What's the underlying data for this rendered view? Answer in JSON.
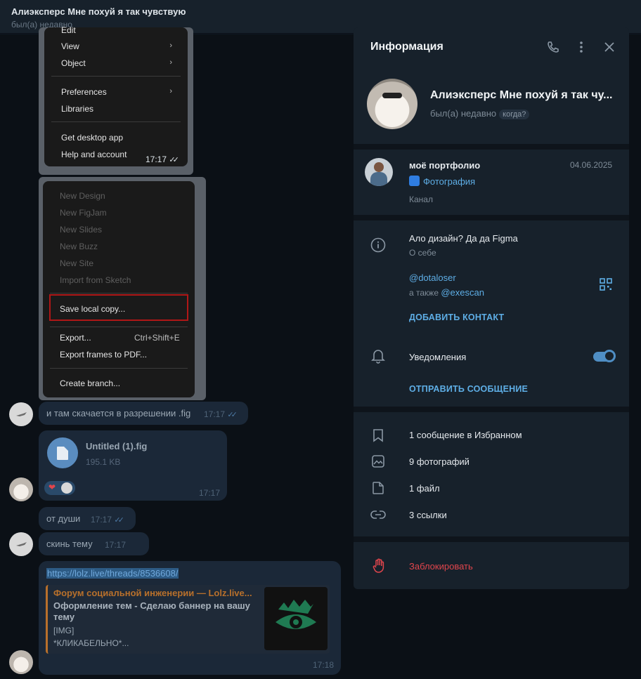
{
  "header": {
    "title": "Алиэксперс Мне похуй я так чувствую",
    "status": "был(а) недавно"
  },
  "menu1": {
    "items": [
      {
        "label": "Edit",
        "arrow": false
      },
      {
        "label": "View",
        "arrow": true
      },
      {
        "label": "Object",
        "arrow": true
      },
      {
        "label": "Preferences",
        "arrow": true
      },
      {
        "label": "Libraries",
        "arrow": false
      },
      {
        "label": "Get desktop app",
        "arrow": false
      },
      {
        "label": "Help and account",
        "arrow": false
      }
    ],
    "time": "17:17"
  },
  "menu2": {
    "items": [
      {
        "label": "New Design",
        "disabled": true
      },
      {
        "label": "New FigJam",
        "disabled": true
      },
      {
        "label": "New Slides",
        "disabled": true
      },
      {
        "label": "New Buzz",
        "disabled": true
      },
      {
        "label": "New Site",
        "disabled": true
      },
      {
        "label": "Import from Sketch",
        "disabled": true
      },
      {
        "label": "Save local copy...",
        "disabled": false
      },
      {
        "label": "Export...",
        "disabled": false
      },
      {
        "label": "Export frames to PDF...",
        "disabled": false
      },
      {
        "label": "Create branch...",
        "disabled": false
      }
    ],
    "export_shortcut": "Ctrl+Shift+E"
  },
  "messages": [
    {
      "text": "и там скачается в разрешении .fig",
      "time": "17:17"
    },
    {
      "text": "от души",
      "time": "17:17"
    },
    {
      "text": "скинь тему",
      "time": "17:17"
    }
  ],
  "file": {
    "name": "Untitled (1).fig",
    "size": "195.1 KB",
    "time": "17:17",
    "reaction": "❤"
  },
  "link_msg": {
    "url": "https://lolz.live/threads/8536608/",
    "site": "Форум социальной инженерии — Lolz.live...",
    "title": "Оформление тем - Сделаю баннер на вашу тему",
    "line1": "[IMG]",
    "line2": "*КЛИКАБЕЛЬНО*...",
    "time": "17:18"
  },
  "panel": {
    "title": "Информация",
    "name": "Алиэксперс Мне похуй я так чу...",
    "status": "был(а) недавно",
    "status_pill": "когда?",
    "channel": {
      "name": "моё портфолио",
      "date": "04.06.2025",
      "subtitle": "Фотография",
      "type": "Канал"
    },
    "bio": "Ало дизайн? Да да Figma",
    "bio_label": "О себе",
    "username": "@dotaloser",
    "also_prefix": "а также",
    "also_user": "@exescan",
    "add_contact": "ДОБАВИТЬ КОНТАКТ",
    "notifications": "Уведомления",
    "send_message": "ОТПРАВИТЬ СООБЩЕНИЕ",
    "saved": "1 сообщение в Избранном",
    "photos": "9 фотографий",
    "files": "1 файл",
    "links": "3 ссылки",
    "block": "Заблокировать"
  },
  "colors": {
    "accent": "#5eaee6",
    "danger": "#e0454c",
    "panel_bg": "#17212b"
  }
}
